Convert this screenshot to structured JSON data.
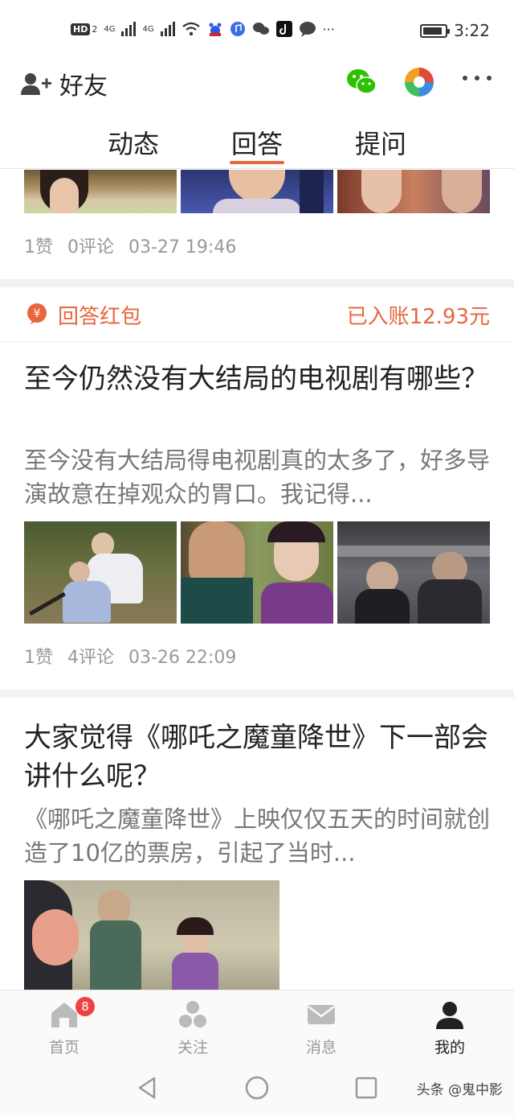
{
  "status_bar": {
    "hd_label": "HD",
    "sim_slot": "2",
    "network1": "4G",
    "network2": "4G",
    "time": "3:22",
    "icons": [
      "hd-icon",
      "signal-icon",
      "signal-icon",
      "wifi-icon",
      "baidu-icon",
      "music-icon",
      "wechat-icon",
      "tiktok-icon",
      "chat-icon"
    ],
    "more": "···"
  },
  "header": {
    "friends_label": "好友",
    "icons": [
      "add-friend-icon",
      "wechat-icon",
      "camera-icon",
      "more-icon"
    ]
  },
  "tabs": [
    {
      "label": "动态",
      "active": false
    },
    {
      "label": "回答",
      "active": true
    },
    {
      "label": "提问",
      "active": false
    }
  ],
  "accent_color": "#e8663d",
  "feed": {
    "post1": {
      "likes": "1赞",
      "comments": "0评论",
      "time": "03-27 19:46"
    },
    "hongbao": {
      "label": "回答红包",
      "amount": "已入账12.93元",
      "icon_glyph": "¥"
    },
    "post2": {
      "title": "至今仍然没有大结局的电视剧有哪些？",
      "excerpt": "至今没有大结局得电视剧真的太多了，好多导演故意在掉观众的胃口。我记得...",
      "likes": "1赞",
      "comments": "4评论",
      "time": "03-26 22:09"
    },
    "post3": {
      "title": "大家觉得《哪吒之魔童降世》下一部会讲什么呢？",
      "excerpt": "《哪吒之魔童降世》上映仅仅五天的时间就创造了10亿的票房，引起了当时..."
    }
  },
  "bottom_nav": [
    {
      "label": "首页",
      "icon": "home-icon",
      "badge": "8"
    },
    {
      "label": "关注",
      "icon": "follow-icon"
    },
    {
      "label": "消息",
      "icon": "message-icon"
    },
    {
      "label": "我的",
      "icon": "profile-icon",
      "active": true
    }
  ],
  "watermark": "头条 @鬼中影"
}
